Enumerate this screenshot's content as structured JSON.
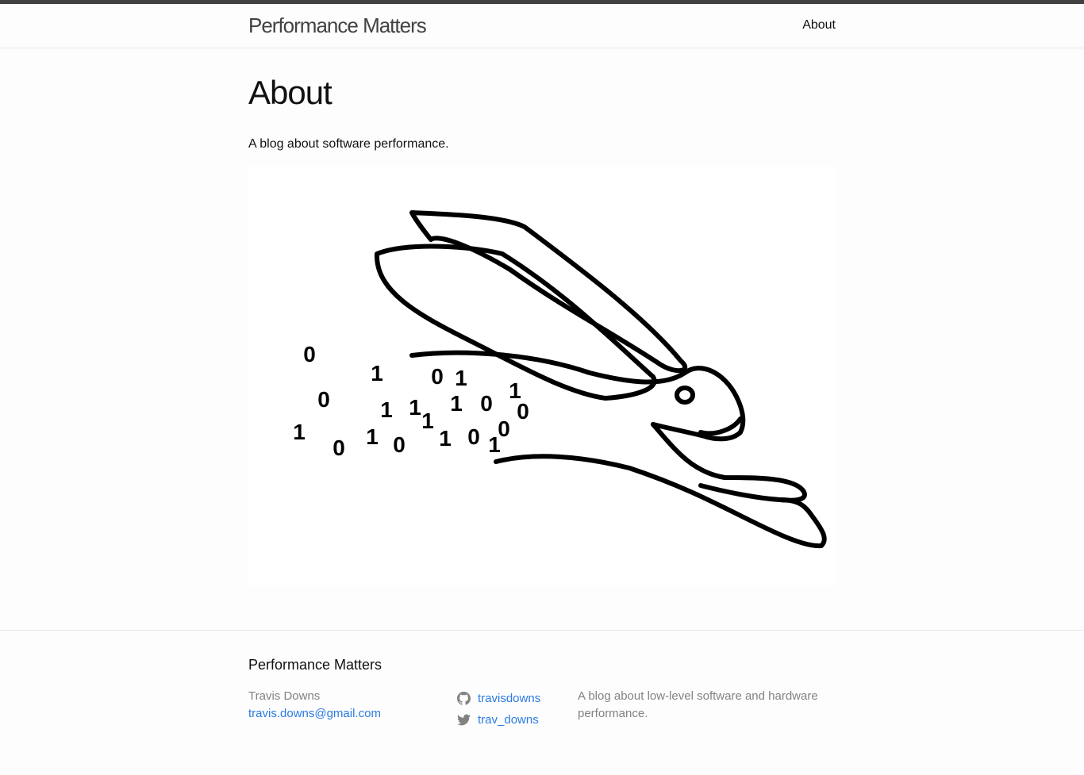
{
  "header": {
    "site_title": "Performance Matters",
    "nav": [
      {
        "label": "About"
      }
    ]
  },
  "page": {
    "title": "About",
    "intro": "A blog about software performance."
  },
  "hero_image": {
    "icon": "rabbit-binary-drawing",
    "digits": [
      "0",
      "1",
      "0",
      "1",
      "0",
      "1",
      "1",
      "1",
      "0",
      "1",
      "0",
      "1",
      "0",
      "0",
      "1",
      "0",
      "0",
      "1",
      "1",
      "1"
    ]
  },
  "footer": {
    "heading": "Performance Matters",
    "author": "Travis Downs",
    "email": "travis.downs@gmail.com",
    "github": "travisdowns",
    "twitter": "trav_downs",
    "description": "A blog about low-level software and hardware performance."
  },
  "colors": {
    "link": "#2a7ae2",
    "top_bar": "#424242",
    "muted": "#828282"
  }
}
